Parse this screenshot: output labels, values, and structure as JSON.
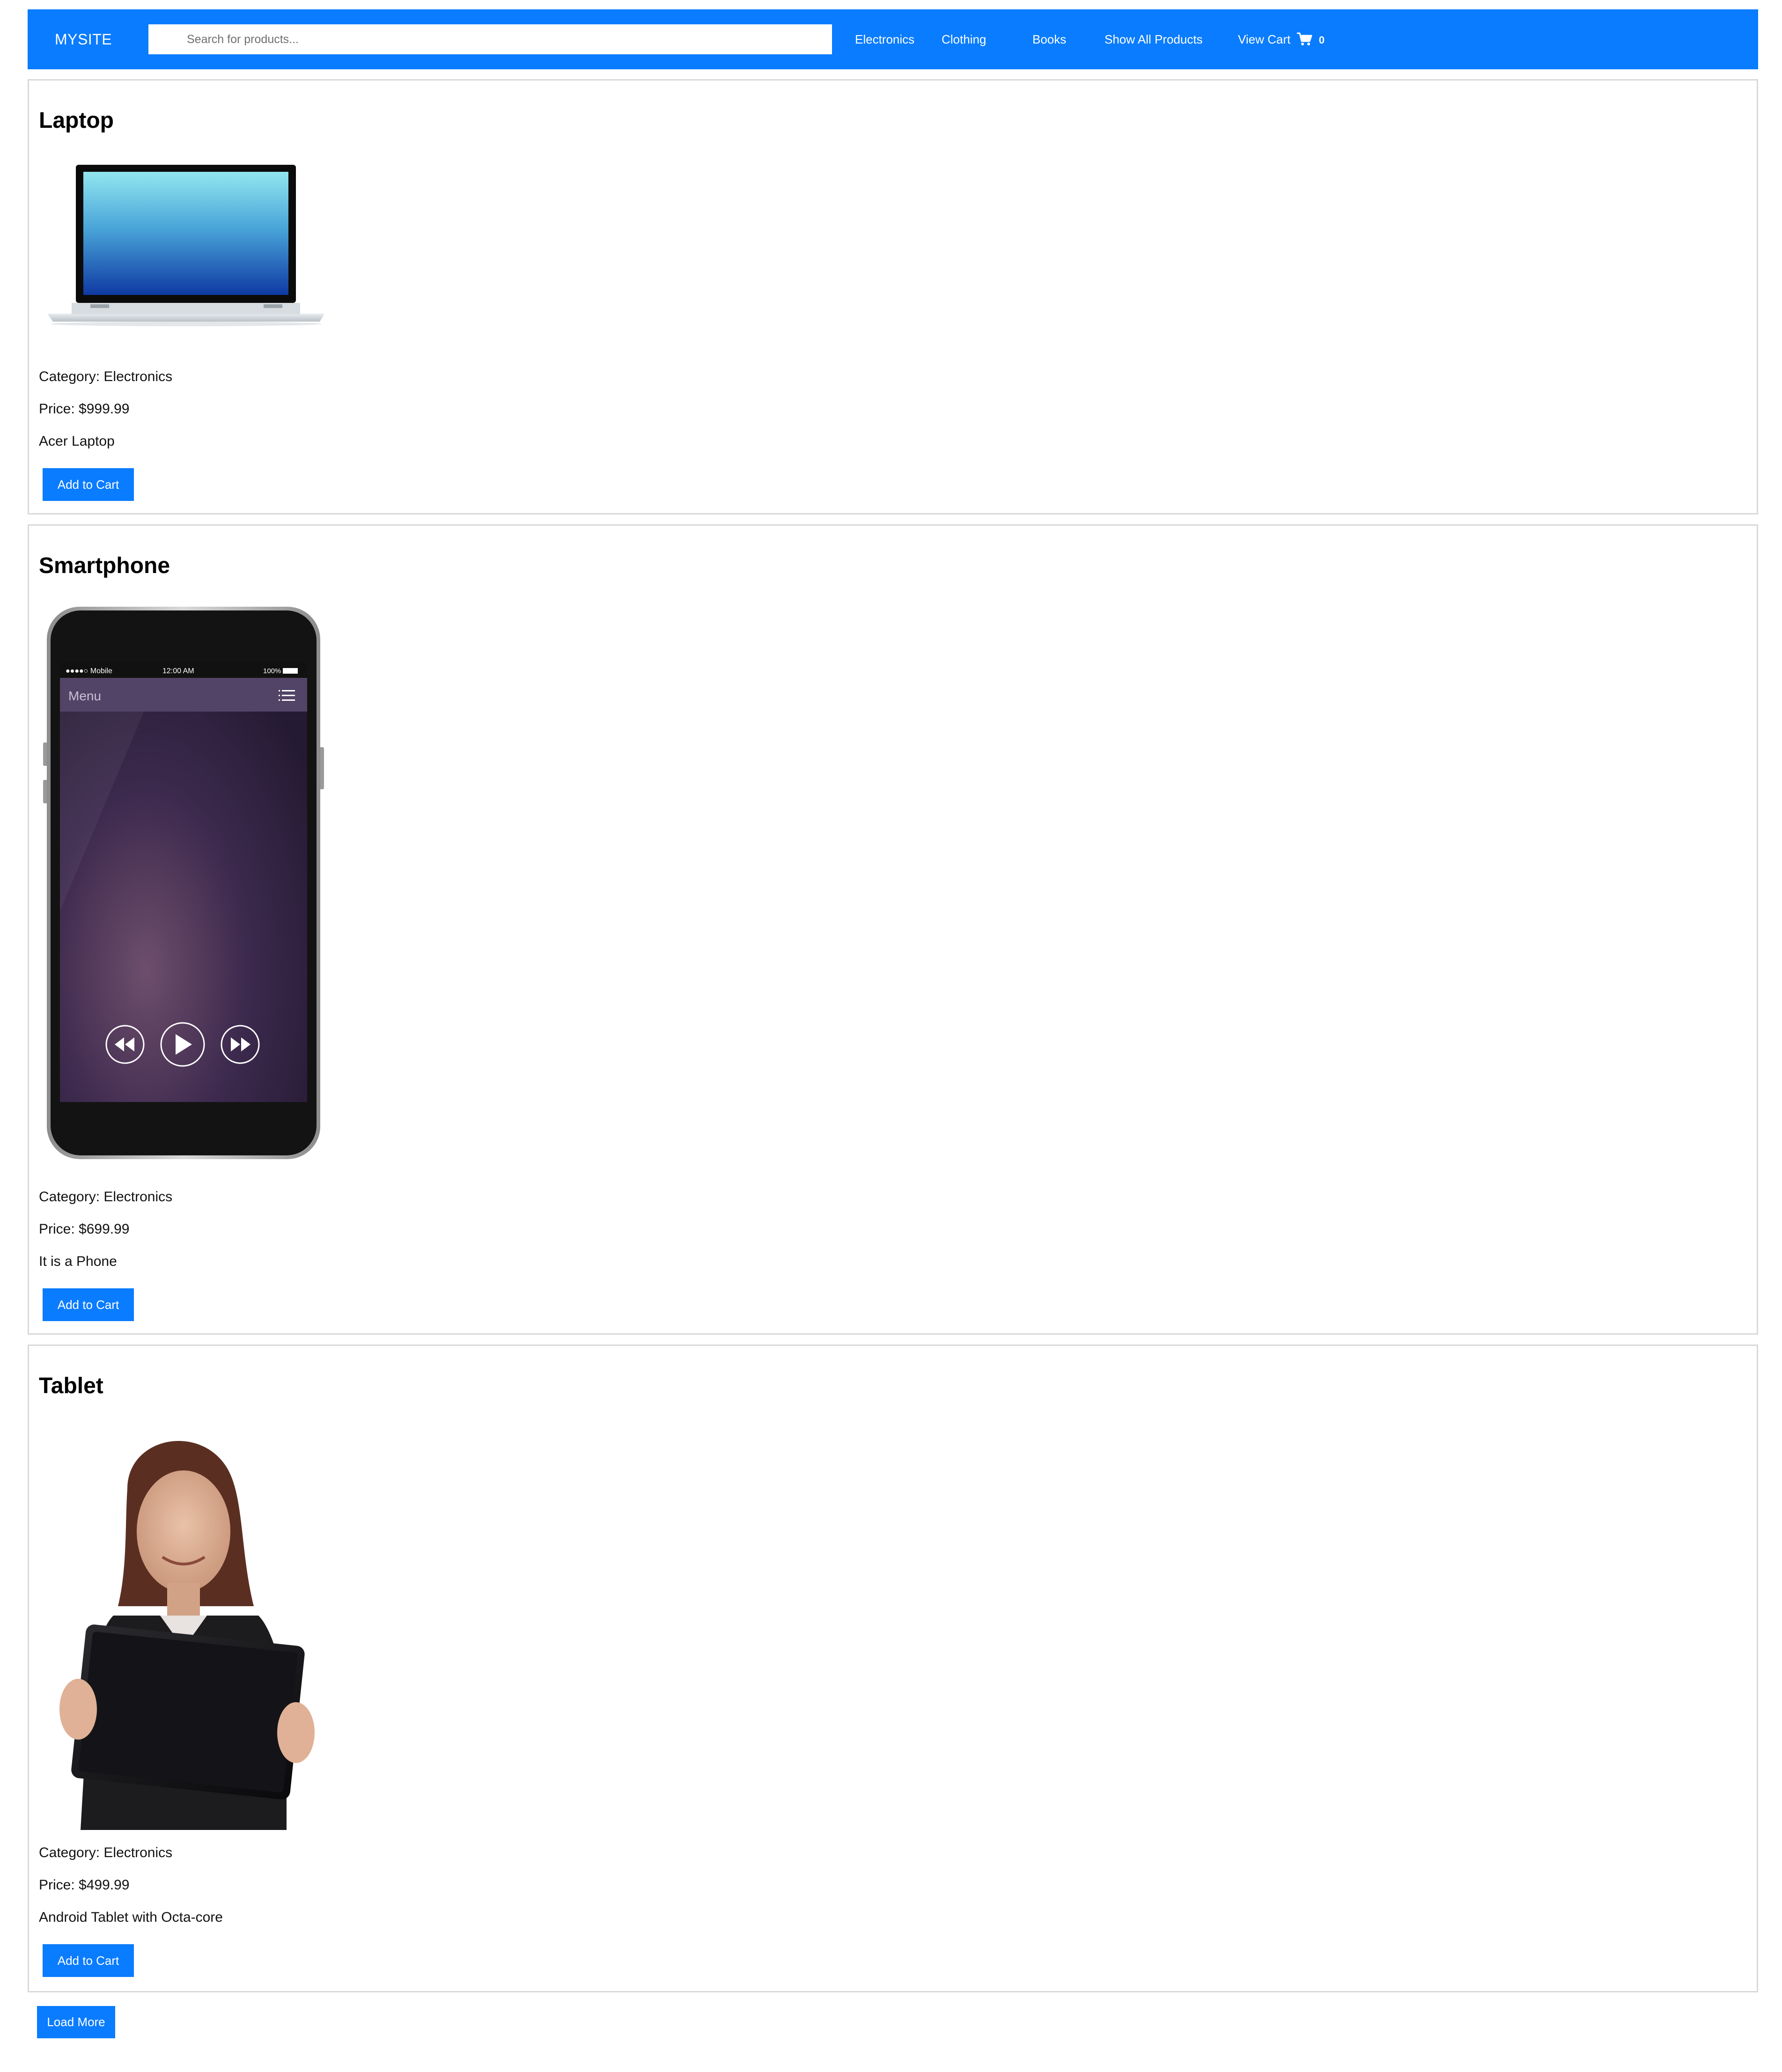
{
  "navbar": {
    "brand": "MYSITE",
    "search_placeholder": "Search for products...",
    "links": [
      "Electronics",
      "Clothing",
      "Books",
      "Show All Products"
    ],
    "cart_label": "View Cart",
    "cart_count": "0",
    "color": "#0a7cff"
  },
  "products": [
    {
      "name": "Laptop",
      "category": "Category: Electronics",
      "price": "Price: $999.99",
      "description": "Acer Laptop",
      "button": "Add to Cart"
    },
    {
      "name": "Smartphone",
      "category": "Category: Electronics",
      "price": "Price: $699.99",
      "description": "It is a Phone",
      "button": "Add to Cart",
      "screen": {
        "carrier": "●●●●○ Mobile",
        "time": "12:00 AM",
        "battery": "100%",
        "menu": "Menu"
      }
    },
    {
      "name": "Tablet",
      "category": "Category: Electronics",
      "price": "Price: $499.99",
      "description": "Android Tablet with Octa-core",
      "button": "Add to Cart"
    }
  ],
  "load_more": "Load More"
}
